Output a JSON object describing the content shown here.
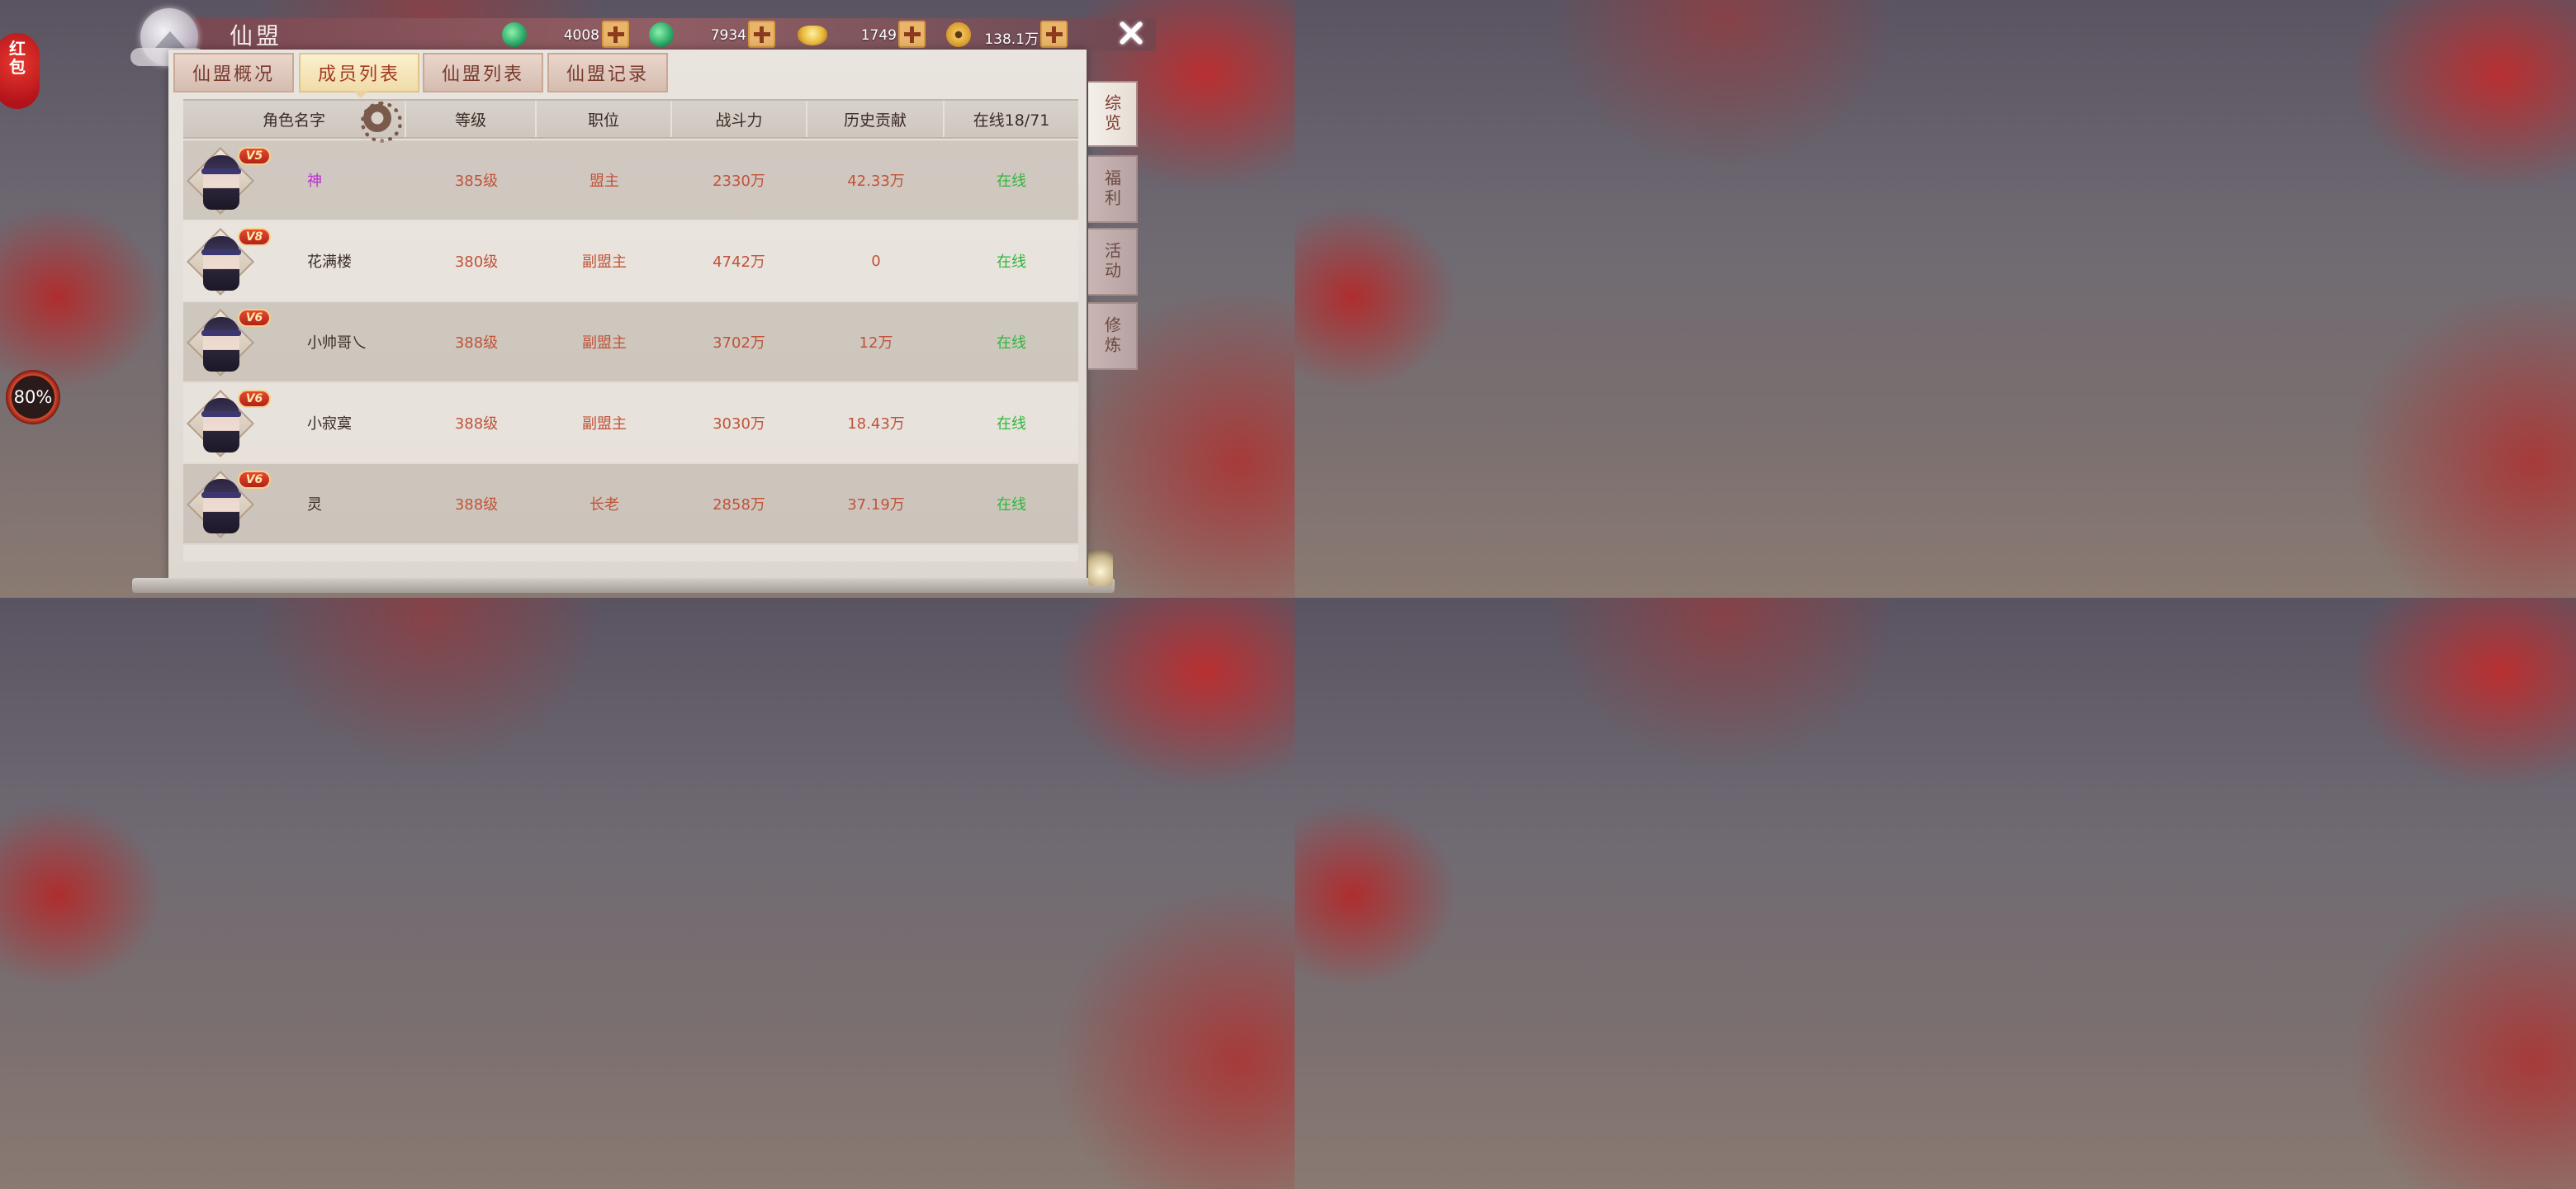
{
  "window": {
    "title": "仙盟",
    "close_icon": "close-icon"
  },
  "currencies": [
    {
      "icon": "jade-icon",
      "color": "#2fae6a",
      "value": "4008"
    },
    {
      "icon": "bound-jade-icon",
      "color": "#2fae6a",
      "value": "7934"
    },
    {
      "icon": "gold-ingot-icon",
      "color": "#e8b83a",
      "value": "1749"
    },
    {
      "icon": "copper-coin-icon",
      "color": "#d99a2a",
      "value": "138.1万"
    }
  ],
  "left_widgets": {
    "red_packet_label_1": "红",
    "red_packet_label_2": "包",
    "progress_text": "80%"
  },
  "tabs": [
    {
      "label": "仙盟概况",
      "active": false
    },
    {
      "label": "成员列表",
      "active": true
    },
    {
      "label": "仙盟列表",
      "active": false
    },
    {
      "label": "仙盟记录",
      "active": false
    }
  ],
  "table": {
    "headers": {
      "name": "角色名字",
      "level": "等级",
      "role": "职位",
      "power": "战斗力",
      "contribution": "历史贡献",
      "online": "在线18/71"
    },
    "rows": [
      {
        "vip": "V5",
        "name": "神",
        "level": "385级",
        "role": "盟主",
        "power": "2330万",
        "contribution": "42.33万",
        "status": "在线"
      },
      {
        "vip": "V8",
        "name": "花满楼",
        "level": "380级",
        "role": "副盟主",
        "power": "4742万",
        "contribution": "0",
        "status": "在线"
      },
      {
        "vip": "V6",
        "name": "小帅哥乀",
        "level": "388级",
        "role": "副盟主",
        "power": "3702万",
        "contribution": "12万",
        "status": "在线"
      },
      {
        "vip": "V6",
        "name": "小寂寞",
        "level": "388级",
        "role": "副盟主",
        "power": "3030万",
        "contribution": "18.43万",
        "status": "在线"
      },
      {
        "vip": "V6",
        "name": "灵",
        "level": "388级",
        "role": "长老",
        "power": "2858万",
        "contribution": "37.19万",
        "status": "在线"
      }
    ]
  },
  "side_tabs": [
    {
      "label": "综览",
      "active": true
    },
    {
      "label": "福利",
      "active": false
    },
    {
      "label": "活动",
      "active": false
    },
    {
      "label": "修炼",
      "active": false
    }
  ],
  "colors": {
    "online_green": "#31b53d",
    "value_orange": "#c0533a",
    "leader_name_purple": "#b72fd0"
  }
}
